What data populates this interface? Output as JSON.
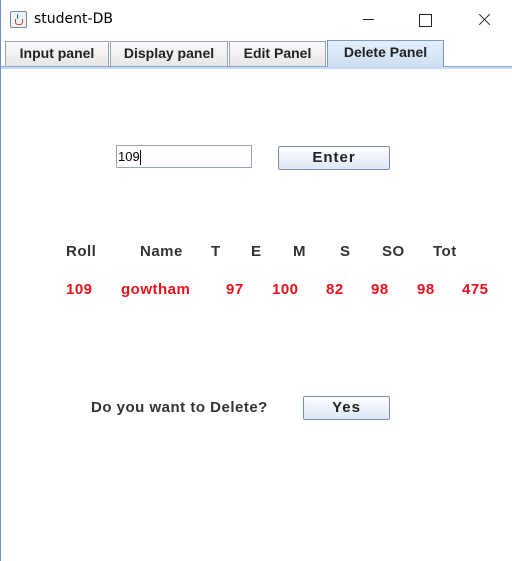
{
  "window": {
    "title": "student-DB"
  },
  "tabs": [
    {
      "label": "Input panel",
      "active": false
    },
    {
      "label": "Display panel",
      "active": false
    },
    {
      "label": "Edit Panel",
      "active": false
    },
    {
      "label": "Delete Panel",
      "active": true
    }
  ],
  "delete_panel": {
    "roll_input_value": "109",
    "enter_label": "Enter",
    "headers": [
      "Roll",
      "Name",
      "T",
      "E",
      "M",
      "S",
      "SO",
      "Tot"
    ],
    "record": [
      "109",
      "gowtham",
      "97",
      "100",
      "82",
      "98",
      "98",
      "475"
    ],
    "confirm_question": "Do you want to Delete?",
    "yes_label": "Yes"
  },
  "colors": {
    "value_text": "#e8101a",
    "tab_active": "#cddff4"
  },
  "icons": [
    "java-app-icon",
    "minimize-icon",
    "maximize-icon",
    "close-icon"
  ]
}
